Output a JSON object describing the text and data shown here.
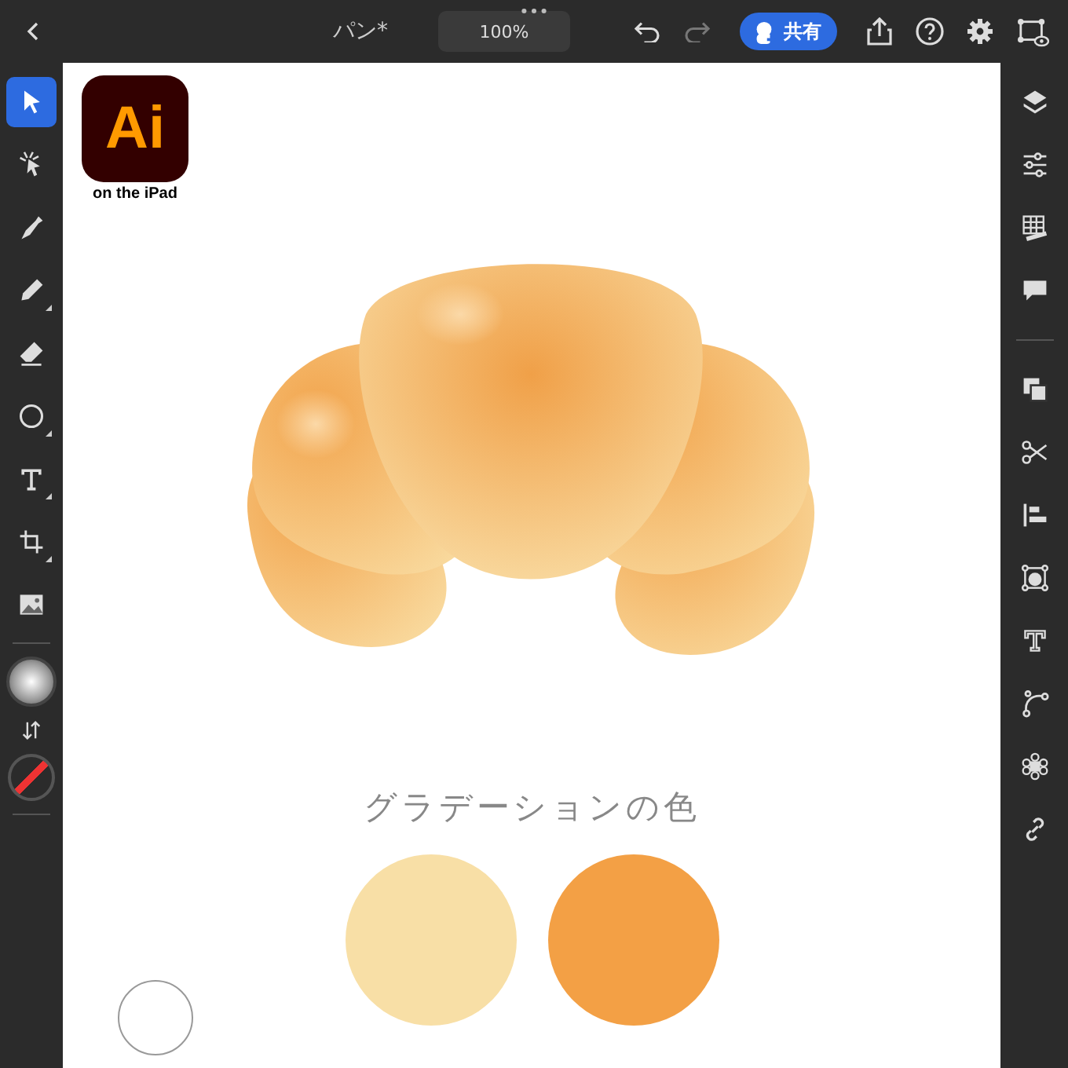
{
  "top_bar": {
    "title": "パン*",
    "zoom": "100%",
    "share_button": "共有"
  },
  "tools": [
    {
      "kind": "select",
      "selected": true,
      "submenu": false
    },
    {
      "kind": "direct",
      "selected": false,
      "submenu": false
    },
    {
      "kind": "pen",
      "selected": false,
      "submenu": false
    },
    {
      "kind": "pencil",
      "selected": false,
      "submenu": true
    },
    {
      "kind": "eraser",
      "selected": false,
      "submenu": false
    },
    {
      "kind": "ellipse",
      "selected": false,
      "submenu": true
    },
    {
      "kind": "type",
      "selected": false,
      "submenu": true
    },
    {
      "kind": "crop",
      "selected": false,
      "submenu": true
    },
    {
      "kind": "image",
      "selected": false,
      "submenu": false
    }
  ],
  "canvas": {
    "logo": {
      "mark": "Ai",
      "caption": "on the iPad"
    },
    "caption": "グラデーションの色",
    "swatches": [
      {
        "color": "#f8dfa6"
      },
      {
        "color": "#f3a045"
      }
    ]
  }
}
